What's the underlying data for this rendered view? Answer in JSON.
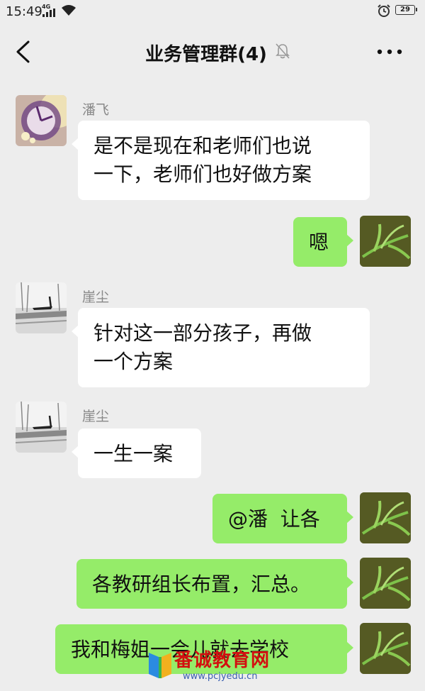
{
  "status_bar": {
    "time": "15:49",
    "network": "4G",
    "battery": "29"
  },
  "header": {
    "title": "业务管理群(4)"
  },
  "messages": [
    {
      "sender": "潘飞",
      "lines": [
        "是不是现在和老师们也说",
        "一下，老师们也好做方案"
      ]
    },
    {
      "text": "嗯"
    },
    {
      "sender": "崖尘",
      "lines": [
        "针对这一部分孩子，再做",
        "一个方案"
      ]
    },
    {
      "sender": "崖尘",
      "text": "一生一案"
    },
    {
      "text": "@潘  让各"
    },
    {
      "text": "各教研组长布置，汇总。"
    },
    {
      "text": "我和梅姐一会儿就去学校"
    }
  ],
  "watermark": {
    "title": "番诚教育网",
    "url": "www.pcjyedu.cn"
  }
}
